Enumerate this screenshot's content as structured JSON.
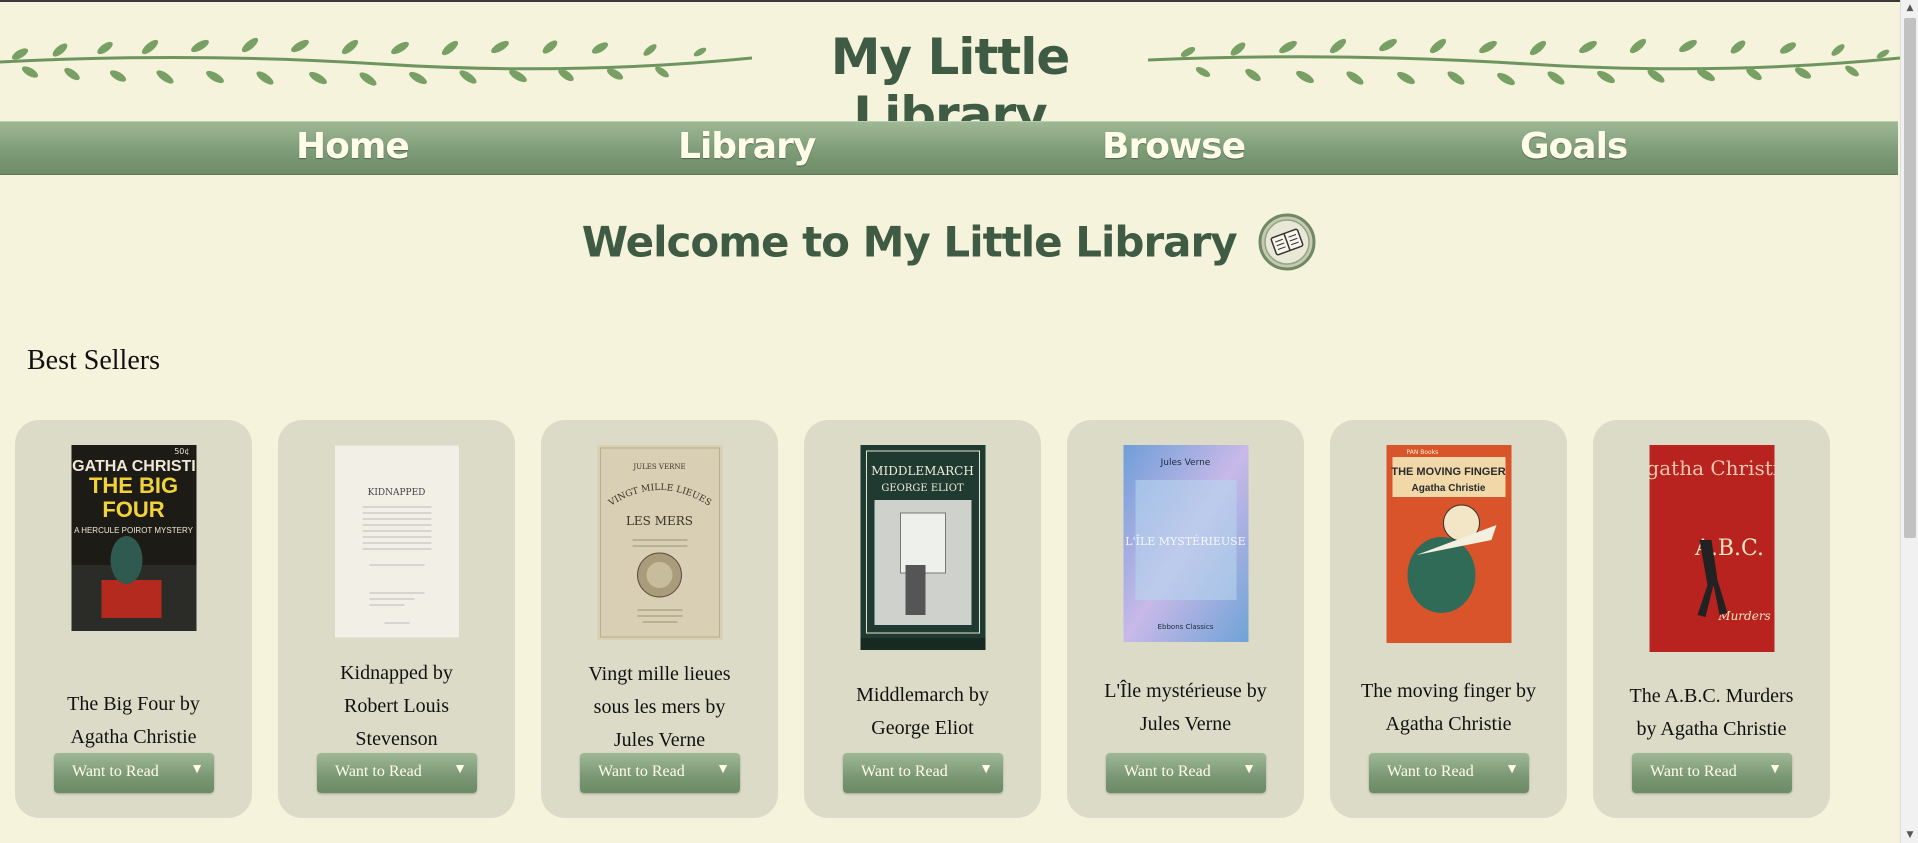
{
  "site": {
    "title": "My Little Library"
  },
  "nav": {
    "items": [
      "Home",
      "Library",
      "Browse",
      "Goals"
    ]
  },
  "welcome": {
    "text": "Welcome to My Little Library"
  },
  "section": {
    "title": "Best Sellers"
  },
  "books": [
    {
      "lines": [
        "The Big Four by",
        "Agatha Christie"
      ],
      "button": "Want to Read",
      "cover_color": "#1c1b16"
    },
    {
      "lines": [
        "Kidnapped by",
        "Robert Louis",
        "Stevenson"
      ],
      "button": "Want to Read",
      "cover_color": "#f2efe6"
    },
    {
      "lines": [
        "Vingt mille lieues",
        "sous les mers by",
        "Jules Verne"
      ],
      "button": "Want to Read",
      "cover_color": "#d8cfb4"
    },
    {
      "lines": [
        "Middlemarch by",
        "George Eliot"
      ],
      "button": "Want to Read",
      "cover_color": "#1f3a30"
    },
    {
      "lines": [
        "L'Île mystérieuse by",
        "Jules Verne"
      ],
      "button": "Want to Read",
      "cover_color": "#7fa8d8"
    },
    {
      "lines": [
        "The moving finger by",
        "Agatha Christie"
      ],
      "button": "Want to Read",
      "cover_color": "#d9542a"
    },
    {
      "lines": [
        "The A.B.C. Murders",
        "by Agatha Christie"
      ],
      "button": "Want to Read",
      "cover_color": "#b8231f"
    }
  ],
  "covers": {
    "big_four": {
      "lines": [
        "AGATHA CHRISTIE",
        "THE BIG",
        "FOUR",
        "A HERCULE POIROT MYSTERY"
      ],
      "price": "50¢"
    },
    "kidnapped": {
      "title": "KIDNAPPED"
    },
    "vingt": {
      "author": "JULES VERNE",
      "title": "VINGT MILLE LIEUES",
      "sub": "LES MERS"
    },
    "middlemarch": {
      "title": "MIDDLEMARCH",
      "author": "GEORGE ELIOT"
    },
    "ile": {
      "author": "Jules Verne",
      "title": "L'ÎLE MYSTÉRIEUSE",
      "publisher": "Ebbons Classics"
    },
    "moving": {
      "title": "THE MOVING FINGER",
      "author": "Agatha Christie",
      "brand": "PAN Books"
    },
    "abc": {
      "author": "Agatha Christie",
      "title": "A.B.C.",
      "sub": "Murders"
    }
  },
  "colors": {
    "accent": "#3f5b44",
    "nav": "#7e9c78",
    "background": "#f5f3dc",
    "card": "#dbdbc7"
  },
  "icons": {
    "welcome": "book-icon",
    "dropdown": "chevron-down-icon"
  }
}
